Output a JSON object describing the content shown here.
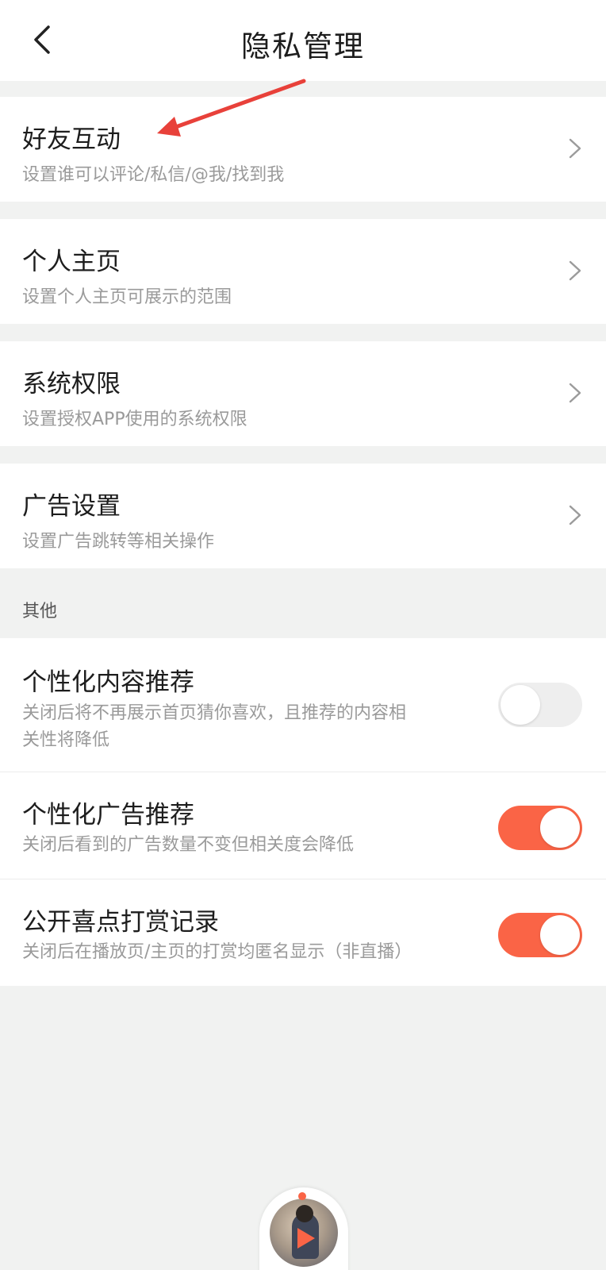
{
  "header": {
    "title": "隐私管理"
  },
  "nav_items": [
    {
      "label": "好友互动",
      "sub": "设置谁可以评论/私信/@我/找到我"
    },
    {
      "label": "个人主页",
      "sub": "设置个人主页可展示的范围"
    },
    {
      "label": "系统权限",
      "sub": "设置授权APP使用的系统权限"
    },
    {
      "label": "广告设置",
      "sub": "设置广告跳转等相关操作"
    }
  ],
  "section_other": "其他",
  "toggles": [
    {
      "label": "个性化内容推荐",
      "sub_line1": "关闭后将不再展示首页猜你喜欢，且推荐的内容相",
      "sub_line2": "关性将降低",
      "on": false
    },
    {
      "label": "个性化广告推荐",
      "sub_line1": "关闭后看到的广告数量不变但相关度会降低",
      "on": true
    },
    {
      "label": "公开喜点打赏记录",
      "sub_line1": "关闭后在播放页/主页的打赏均匿名显示（非直播）",
      "on": true
    }
  ],
  "colors": {
    "accent": "#fa6446",
    "arrow": "#e8413a",
    "background": "#f1f2f1"
  },
  "icons": {
    "back": "chevron-left-icon",
    "row": "chevron-right-icon",
    "annotation": "red-arrow-annotation"
  }
}
